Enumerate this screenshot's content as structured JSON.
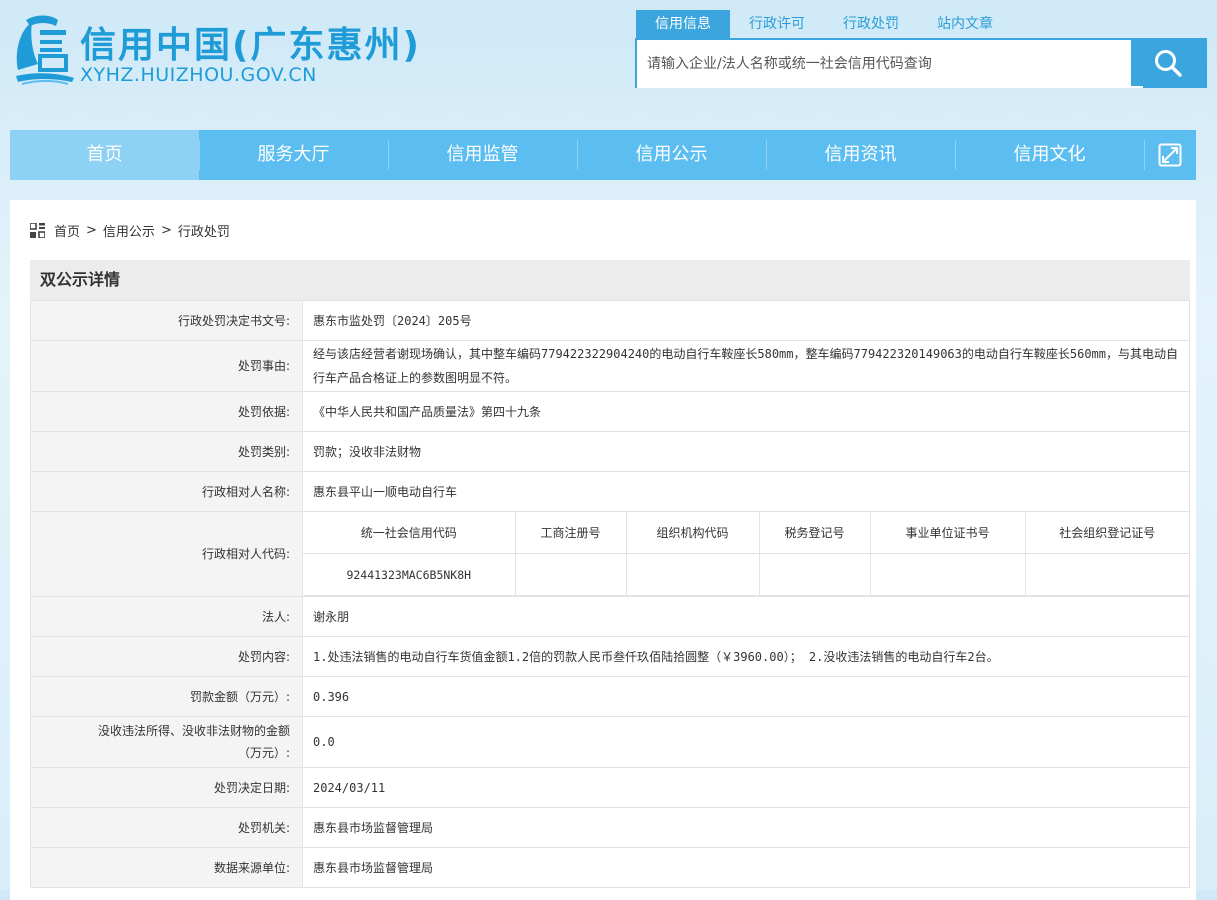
{
  "header": {
    "title": "信用中国(广东惠州)",
    "url": "XYHZ.HUIZHOU.GOV.CN",
    "search_tabs": [
      "信用信息",
      "行政许可",
      "行政处罚",
      "站内文章"
    ],
    "search_placeholder": "请输入企业/法人名称或统一社会信用代码查询"
  },
  "nav": {
    "items": [
      "首页",
      "服务大厅",
      "信用监管",
      "信用公示",
      "信用资讯",
      "信用文化"
    ]
  },
  "breadcrumb": [
    "首页",
    "信用公示",
    "行政处罚"
  ],
  "breadcrumb_sep": ">",
  "section_title": "双公示详情",
  "detail": {
    "decision_no_label": "行政处罚决定书文号:",
    "decision_no": "惠东市监处罚〔2024〕205号",
    "reason_label": "处罚事由:",
    "reason": "经与该店经营者谢现场确认，其中整车编码779422322904240的电动自行车鞍座长580mm，整车编码779422320149063的电动自行车鞍座长560mm，与其电动自行车产品合格证上的参数图明显不符。",
    "basis_label": "处罚依据:",
    "basis": "《中华人民共和国产品质量法》第四十九条",
    "category_label": "处罚类别:",
    "category": "罚款；没收非法财物",
    "party_name_label": "行政相对人名称:",
    "party_name": "惠东县平山一顺电动自行车",
    "party_code_label": "行政相对人代码:",
    "code_headers": [
      "统一社会信用代码",
      "工商注册号",
      "组织机构代码",
      "税务登记号",
      "事业单位证书号",
      "社会组织登记证号"
    ],
    "code_values": [
      "92441323MAC6B5NK8H",
      "",
      "",
      "",
      "",
      ""
    ],
    "legal_rep_label": "法人:",
    "legal_rep": "谢永朋",
    "content_label": "处罚内容:",
    "content": "1.处违法销售的电动自行车货值金额1.2倍的罚款人民币叁仟玖佰陆拾圆整（￥3960.00）； 2.没收违法销售的电动自行车2台。",
    "fine_label": "罚款金额（万元）:",
    "fine": "0.396",
    "confiscation_label": "没收违法所得、没收非法财物的金额（万元）:",
    "confiscation": "0.0",
    "date_label": "处罚决定日期:",
    "date": "2024/03/11",
    "authority_label": "处罚机关:",
    "authority": "惠东县市场监督管理局",
    "source_label": "数据来源单位:",
    "source": "惠东县市场监督管理局"
  },
  "colors": {
    "brand": "#1f9cd8",
    "nav_bg": "#5bbdf0",
    "nav_active": "#8dd2f5",
    "search_accent": "#3aa6dd"
  },
  "icons": [
    "logo-emblem",
    "search-icon",
    "expand-icon",
    "grid-icon"
  ]
}
